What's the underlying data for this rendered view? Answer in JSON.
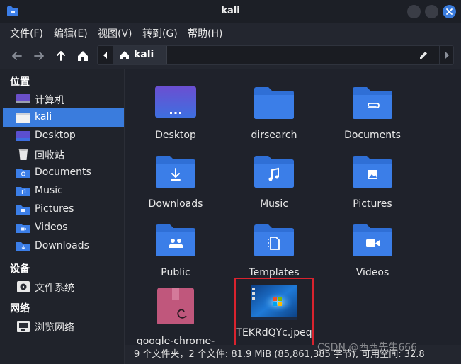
{
  "window": {
    "title": "kali"
  },
  "menu": [
    {
      "label": "文件(F)"
    },
    {
      "label": "编辑(E)"
    },
    {
      "label": "视图(V)"
    },
    {
      "label": "转到(G)"
    },
    {
      "label": "帮助(H)"
    }
  ],
  "path": {
    "current": "kali"
  },
  "sidebar": {
    "places_title": "位置",
    "places": [
      {
        "label": "计算机",
        "icon": "computer-icon"
      },
      {
        "label": "kali",
        "icon": "home-folder-icon",
        "active": true
      },
      {
        "label": "Desktop",
        "icon": "desktop-icon"
      },
      {
        "label": "回收站",
        "icon": "trash-icon"
      },
      {
        "label": "Documents",
        "icon": "documents-folder-icon"
      },
      {
        "label": "Music",
        "icon": "music-folder-icon"
      },
      {
        "label": "Pictures",
        "icon": "pictures-folder-icon"
      },
      {
        "label": "Videos",
        "icon": "videos-folder-icon"
      },
      {
        "label": "Downloads",
        "icon": "downloads-folder-icon"
      }
    ],
    "devices_title": "设备",
    "devices": [
      {
        "label": "文件系统",
        "icon": "drive-icon"
      }
    ],
    "network_title": "网络",
    "network": [
      {
        "label": "浏览网络",
        "icon": "network-icon"
      }
    ]
  },
  "files": [
    {
      "name": "Desktop",
      "icon": "desktop-icon"
    },
    {
      "name": "dirsearch",
      "icon": "folder-icon"
    },
    {
      "name": "Documents",
      "icon": "documents-folder-icon"
    },
    {
      "name": "Downloads",
      "icon": "downloads-folder-icon"
    },
    {
      "name": "Music",
      "icon": "music-folder-icon"
    },
    {
      "name": "Pictures",
      "icon": "pictures-folder-icon"
    },
    {
      "name": "Public",
      "icon": "public-folder-icon"
    },
    {
      "name": "Templates",
      "icon": "templates-folder-icon"
    },
    {
      "name": "Videos",
      "icon": "videos-folder-icon"
    },
    {
      "name": "google-chrome-",
      "icon": "deb-package-icon"
    },
    {
      "name": "TEKRdQYc.jpeq",
      "icon": "image-thumbnail-icon"
    }
  ],
  "status": {
    "text": "9 个文件夹，2 个文件: 81.9 MiB (85,861,385 字节), 可用空间: 32.8"
  },
  "watermark": "CSDN @西西先生666",
  "colors": {
    "accent": "#3a7cdd",
    "folder": "#3b7ee8",
    "highlight_box": "#d9232e"
  }
}
